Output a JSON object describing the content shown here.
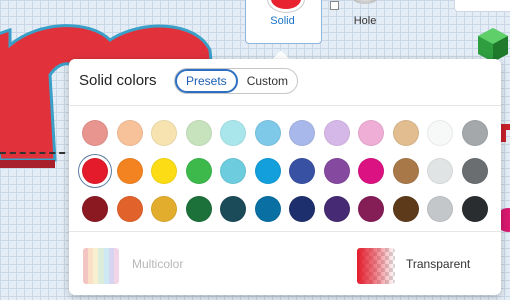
{
  "toolbar": {
    "solid_label": "Solid",
    "hole_label": "Hole",
    "solid_color": "#e8232f"
  },
  "popup": {
    "title": "Solid colors",
    "tabs": [
      {
        "label": "Presets",
        "active": true
      },
      {
        "label": "Custom",
        "active": false
      }
    ],
    "selected_color": "#e31b2b",
    "swatches": [
      [
        "#e8958f",
        "#f7c199",
        "#f6e3b0",
        "#c7e3bd",
        "#a8e6ec",
        "#7fc9e8",
        "#a9b8ea",
        "#d6b8e8",
        "#efaed5",
        "#e1bd8f",
        "#f7f8f8",
        "#a4a8ab"
      ],
      [
        "#e31b2b",
        "#f38321",
        "#fbdc15",
        "#3db94c",
        "#6dccde",
        "#129fdb",
        "#3851a3",
        "#854aa0",
        "#db1281",
        "#a87849",
        "#e1e4e5",
        "#6a6e71"
      ],
      [
        "#8a1922",
        "#e1622a",
        "#e2ad2d",
        "#1b7139",
        "#1b4a59",
        "#0a70a3",
        "#1d2f6c",
        "#462a73",
        "#851d57",
        "#5d3a1a",
        "#c3c7ca",
        "#2a2d2f"
      ]
    ],
    "multicolor_label": "Multicolor",
    "multicolor_stripes": [
      "#e89793",
      "#f6c79b",
      "#f1e2a5",
      "#bfe0bc",
      "#a9d8ec",
      "#b5b3e6",
      "#e8b1d4"
    ],
    "transparent_label": "Transparent"
  }
}
